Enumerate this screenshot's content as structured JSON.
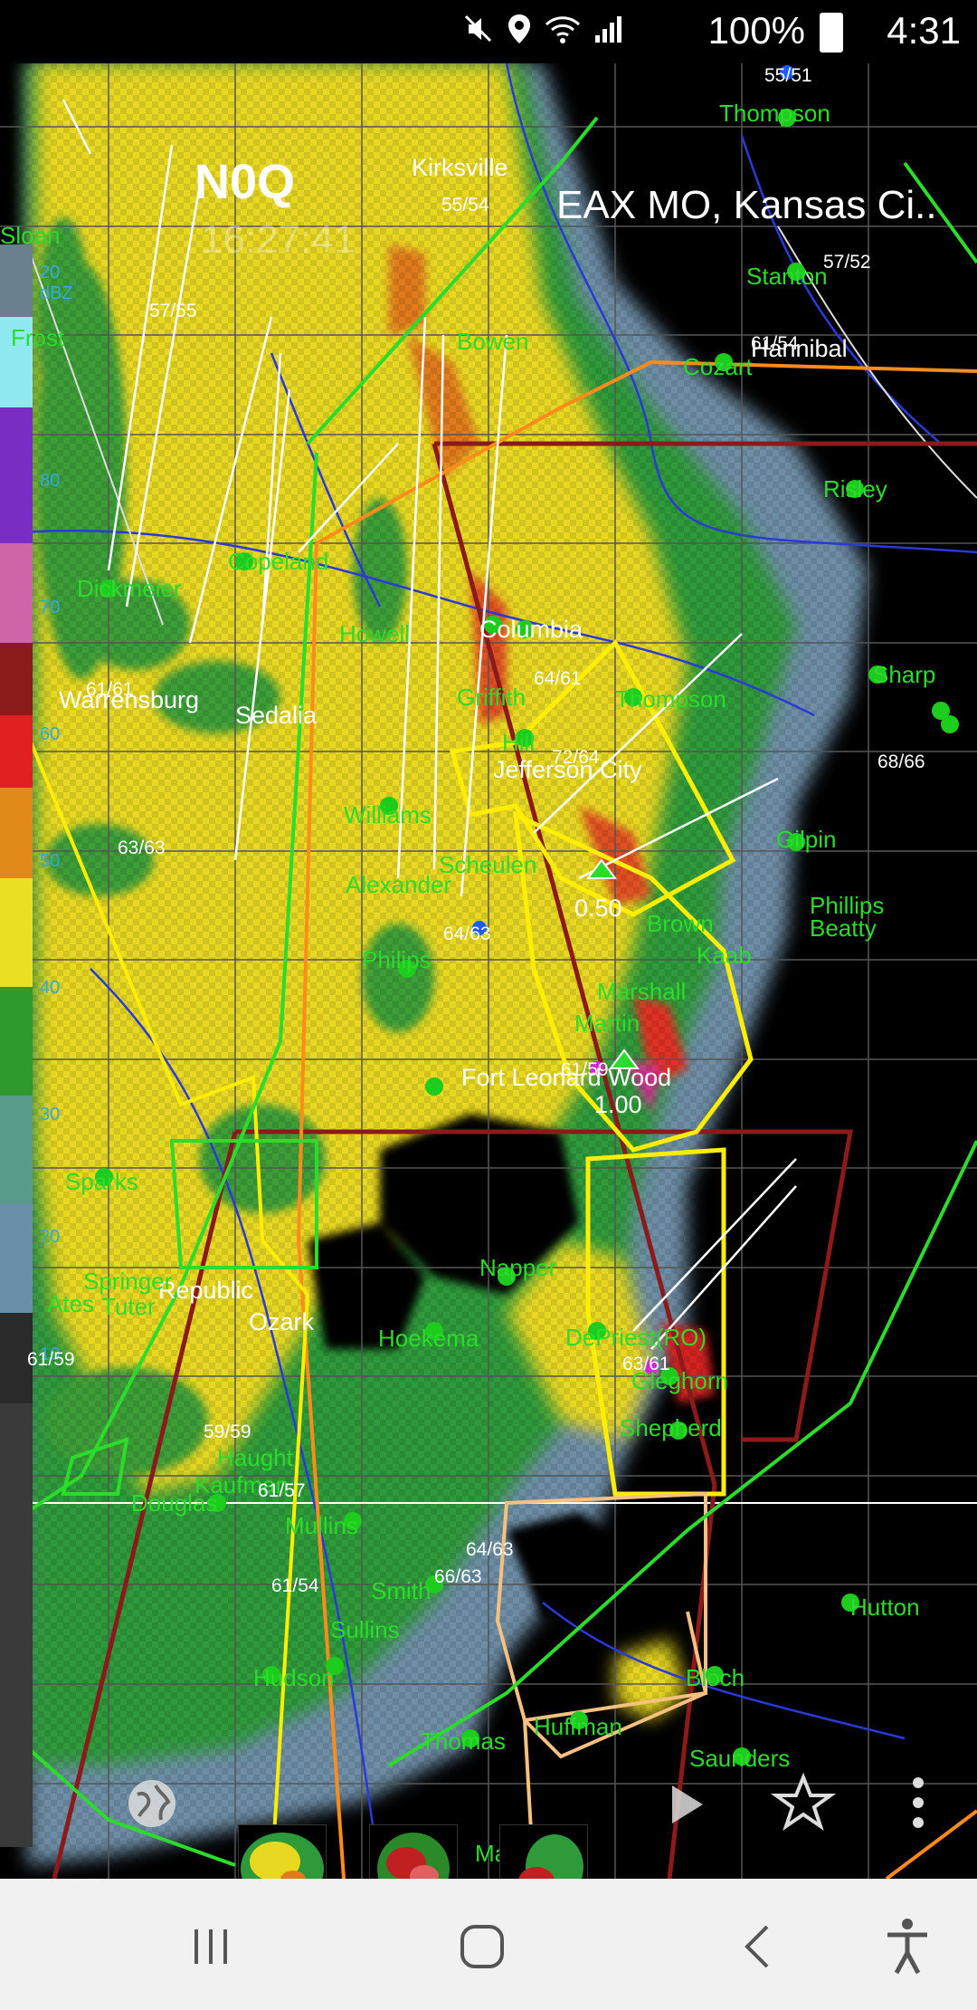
{
  "status_bar": {
    "battery_percent": "100%",
    "clock": "4:31",
    "icons": [
      "mute-icon",
      "location-icon",
      "wifi-icon",
      "signal-icon",
      "battery-icon"
    ]
  },
  "radar": {
    "product": "N0Q",
    "timestamp": "16:27:41",
    "station": "EAX MO, Kansas Ci..",
    "legend_ticks": [
      "20 dBZ",
      "80",
      "70",
      "60",
      "50",
      "40",
      "30",
      "20",
      "10"
    ]
  },
  "map_labels": {
    "cities": [
      "Kirksville",
      "Hannibal",
      "Sedalia",
      "Columbia",
      "Jefferson City",
      "Fort Leonard Wood",
      "Republic",
      "Ozark",
      "Warrensburg"
    ],
    "sites": [
      "Thompson",
      "Sloan",
      "Frost",
      "Bowen",
      "Cozart",
      "Stanton",
      "Risley",
      "Copeland",
      "Dickmeier",
      "Howell",
      "Griffith",
      "Thompson",
      "Hill",
      "Williams",
      "Alexander",
      "Scheulen",
      "Philips",
      "Brown",
      "Kaab",
      "Marshall",
      "Martin",
      "Phillips",
      "Beatty",
      "Gilpin",
      "Sharp",
      "Sparks",
      "Napper",
      "Hoekema",
      "DePriest(RO)",
      "Gleghorn",
      "Shepherd",
      "Haught",
      "Mullins",
      "Smith",
      "Sullins",
      "Hudson",
      "Thomas",
      "Huffman",
      "Bloch",
      "Saunders",
      "Hutton",
      "Martinez",
      "Douglas",
      "Kaufman",
      "Tuter",
      "Ates",
      "Springer"
    ],
    "observations": [
      "55/51",
      "55/54",
      "57/55",
      "57/52",
      "61/54",
      "64/61",
      "72/64",
      "61/61",
      "68/66",
      "63/63",
      "64/63",
      "61/59",
      "61/59",
      "59/59",
      "61/57",
      "61/54",
      "64/63",
      "66/63",
      "63/61"
    ],
    "warning_values": [
      "0.50",
      "1.00"
    ]
  },
  "controls": {
    "play_icon": "play-icon",
    "favorite_icon": "star-icon",
    "menu_icon": "more-vert-icon",
    "globe_icon": "globe-icon"
  },
  "nav_bar": {
    "icons": [
      "recent-apps-icon",
      "home-icon",
      "back-icon",
      "accessibility-icon"
    ]
  },
  "colors": {
    "site_green": "#2bdc2b",
    "warning_yellow": "#ffee00",
    "warning_red": "#8b1a1a",
    "warning_orange": "#ff8c1a"
  }
}
